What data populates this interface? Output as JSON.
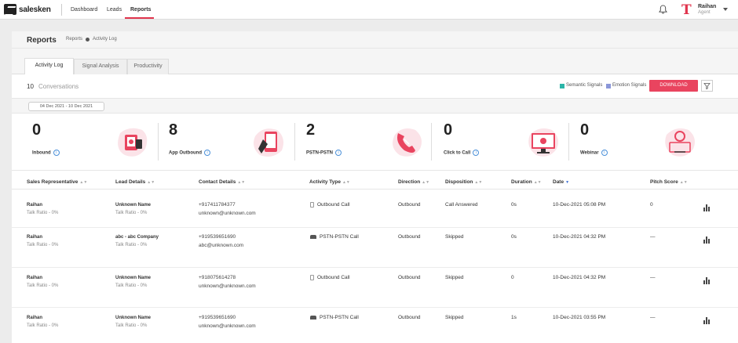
{
  "nav": {
    "logo_text": "salesken",
    "items": [
      "Dashboard",
      "Leads",
      "Reports"
    ],
    "active": "Reports",
    "user": {
      "initial": "T",
      "name": "Raihan",
      "role": "Agent"
    }
  },
  "header": {
    "title": "Reports",
    "breadcrumb": [
      "Reports",
      "Activity Log"
    ]
  },
  "tabs": [
    "Activity Log",
    "Signal Analysis",
    "Productivity"
  ],
  "summary": {
    "count": "10",
    "label": "Conversations",
    "legend": [
      {
        "label": "Semantic Signals",
        "color": "#2bb5a8"
      },
      {
        "label": "Emotion Signals",
        "color": "#8b97d9"
      }
    ],
    "download_label": "DOWNLOAD"
  },
  "date_range": "04 Dec 2021 - 10 Dec 2021",
  "stats": [
    {
      "value": "0",
      "label": "Inbound"
    },
    {
      "value": "8",
      "label": "App Outbound"
    },
    {
      "value": "2",
      "label": "PSTN-PSTN"
    },
    {
      "value": "0",
      "label": "Click to Call"
    },
    {
      "value": "0",
      "label": "Webinar"
    }
  ],
  "columns": [
    "Sales Representative",
    "Lead Details",
    "Contact Details",
    "Activity Type",
    "Direction",
    "Disposition",
    "Duration",
    "Date",
    "Pitch Score"
  ],
  "rows": [
    {
      "rep": "Raihan",
      "rep_ratio": "Talk Ratio - 0%",
      "lead": "Unknown Name",
      "lead_ratio": "Talk Ratio - 0%",
      "phone": "+917411784377",
      "email": "unknown@unknown.com",
      "activity": "Outbound Call",
      "activity_icon": "mobile-icon",
      "direction": "Outbound",
      "disposition": "Call Answered",
      "duration": "0s",
      "date": "10-Dec-2021 05:08 PM",
      "pitch": "0"
    },
    {
      "rep": "Raihan",
      "rep_ratio": "Talk Ratio - 0%",
      "lead": "abc - abc Company",
      "lead_ratio": "Talk Ratio - 0%",
      "phone": "+919539651690",
      "email": "abc@unknown.com",
      "activity": "PSTN-PSTN Call",
      "activity_icon": "telephone-icon",
      "direction": "Outbound",
      "disposition": "Skipped",
      "duration": "0s",
      "date": "10-Dec-2021 04:32 PM",
      "pitch": "—"
    },
    {
      "rep": "Raihan",
      "rep_ratio": "Talk Ratio - 0%",
      "lead": "Unknown Name",
      "lead_ratio": "Talk Ratio - 0%",
      "phone": "+918075614278",
      "email": "unknown@unknown.com",
      "activity": "Outbound Call",
      "activity_icon": "mobile-icon",
      "direction": "Outbound",
      "disposition": "Skipped",
      "duration": "0",
      "date": "10-Dec-2021 04:32 PM",
      "pitch": "—"
    },
    {
      "rep": "Raihan",
      "rep_ratio": "Talk Ratio - 0%",
      "lead": "Unknown Name",
      "lead_ratio": "Talk Ratio - 0%",
      "phone": "+919539651690",
      "email": "unknown@unknown.com",
      "activity": "PSTN-PSTN Call",
      "activity_icon": "telephone-icon",
      "direction": "Outbound",
      "disposition": "Skipped",
      "duration": "1s",
      "date": "10-Dec-2021 03:55 PM",
      "pitch": "—"
    }
  ]
}
